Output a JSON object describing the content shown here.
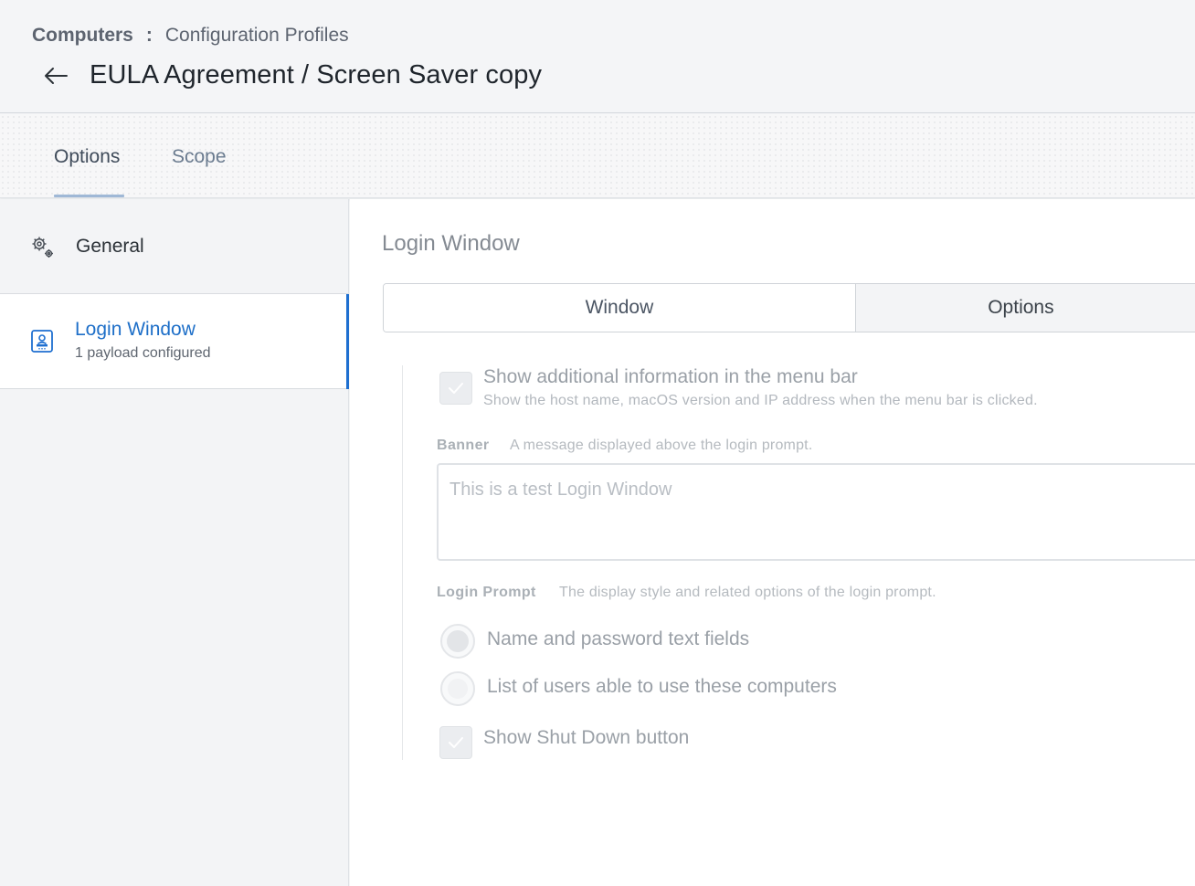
{
  "breadcrumb": {
    "root": "Computers",
    "separator": ":",
    "current": "Configuration Profiles"
  },
  "header": {
    "title": "EULA Agreement / Screen Saver copy"
  },
  "tabs": [
    {
      "label": "Options",
      "active": true
    },
    {
      "label": "Scope",
      "active": false
    }
  ],
  "sidebar": {
    "items": [
      {
        "label": "General",
        "icon": "gear-icon"
      },
      {
        "label": "Login Window",
        "subtitle": "1 payload configured",
        "icon": "login-window-icon",
        "active": true
      }
    ]
  },
  "main": {
    "section_title": "Login Window",
    "segments": [
      {
        "label": "Window",
        "selected": true
      },
      {
        "label": "Options",
        "selected": false
      }
    ],
    "menu_bar_info": {
      "label": "Show additional information in the menu bar",
      "help": "Show the host name, macOS version and IP address when the menu bar is clicked.",
      "checked": true
    },
    "banner": {
      "label": "Banner",
      "help": "A message displayed above the login prompt.",
      "value": "This is a test Login Window"
    },
    "login_prompt": {
      "label": "Login Prompt",
      "help": "The display style and related options of the login prompt.",
      "options": [
        {
          "label": "Name and password text fields",
          "selected": true
        },
        {
          "label": "List of users able to use these computers",
          "selected": false
        }
      ]
    },
    "shutdown": {
      "label": "Show Shut Down button",
      "checked": true
    }
  },
  "colors": {
    "accent": "#1e6fd0",
    "link": "#1e6fc8",
    "tab_underline": "#9fb8d6"
  }
}
